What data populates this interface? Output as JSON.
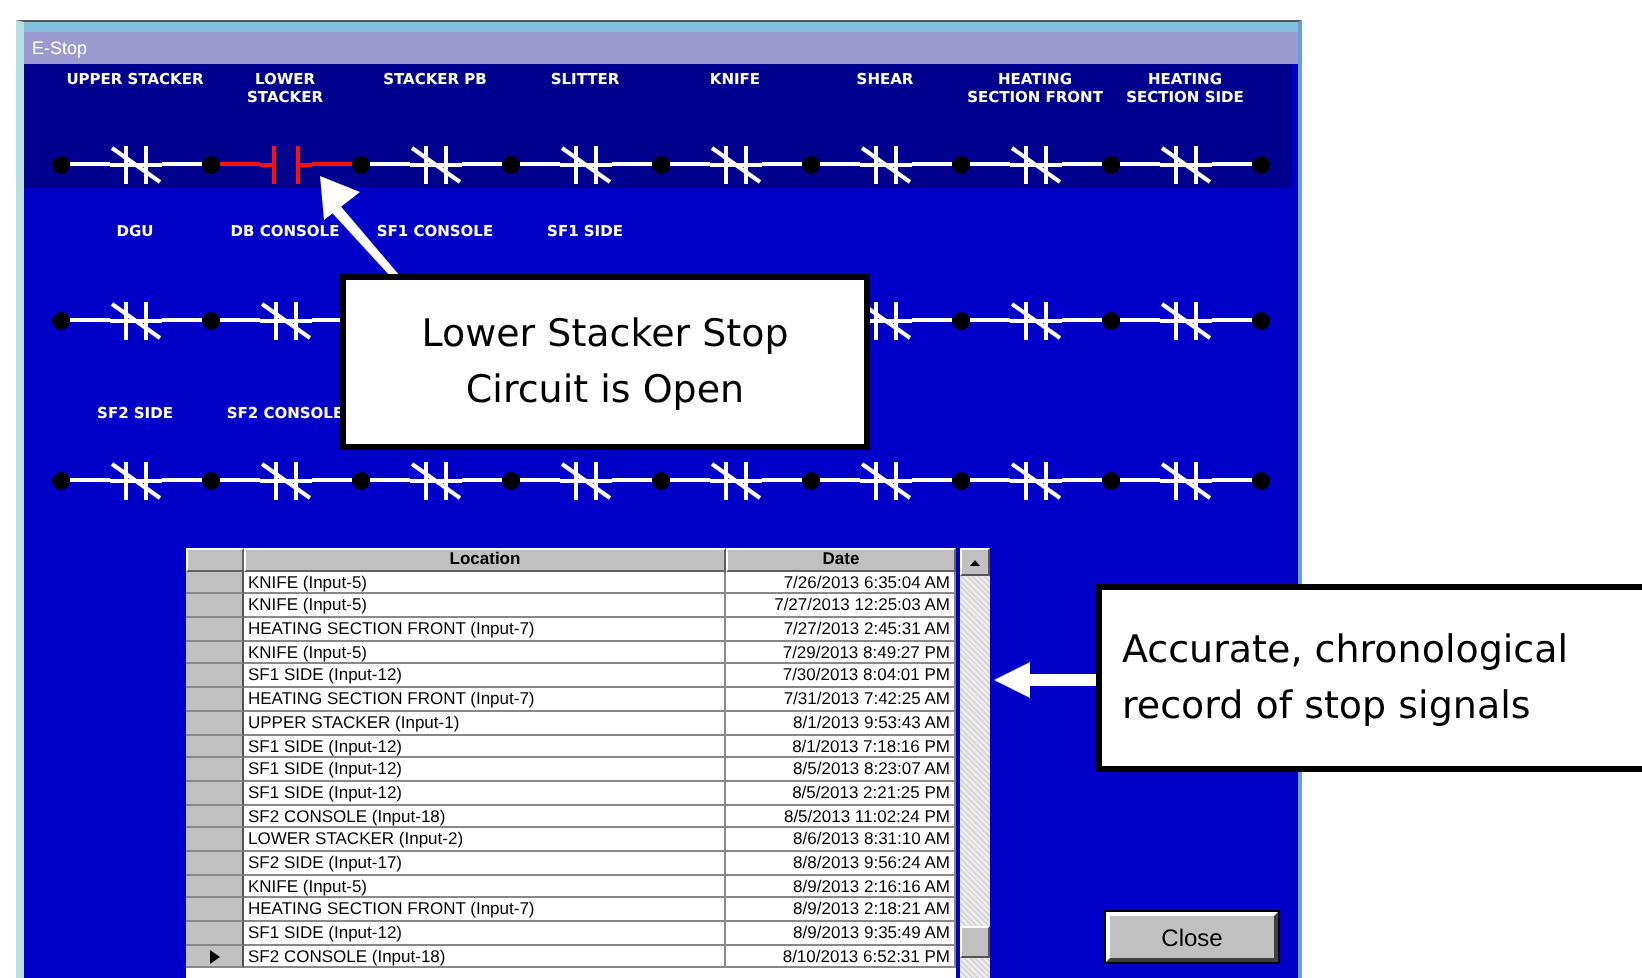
{
  "window": {
    "title": "E-Stop"
  },
  "rungs": [
    {
      "contacts": [
        {
          "label": "UPPER STACKER",
          "open": false
        },
        {
          "label": "LOWER STACKER",
          "open": true
        },
        {
          "label": "STACKER PB",
          "open": false
        },
        {
          "label": "SLITTER",
          "open": false
        },
        {
          "label": "KNIFE",
          "open": false
        },
        {
          "label": "SHEAR",
          "open": false
        },
        {
          "label": "HEATING SECTION FRONT",
          "open": false
        },
        {
          "label": "HEATING SECTION SIDE",
          "open": false
        }
      ]
    },
    {
      "contacts": [
        {
          "label": "DGU",
          "open": false
        },
        {
          "label": "DB CONSOLE",
          "open": false
        },
        {
          "label": "SF1 CONSOLE"
        },
        {
          "label": "SF1 SIDE"
        }
      ],
      "contacts_after_callout": [
        {
          "open": false
        },
        {
          "open": false
        },
        {
          "open": false
        }
      ]
    },
    {
      "contacts": [
        {
          "label": "SF2 SIDE",
          "open": false
        },
        {
          "label": "SF2 CONSOLE",
          "open": false
        },
        {
          "open": false
        },
        {
          "open": false
        },
        {
          "open": false
        },
        {
          "open": false
        },
        {
          "open": false
        },
        {
          "open": false
        }
      ]
    }
  ],
  "table": {
    "columns": [
      "Location",
      "Date"
    ],
    "rows": [
      {
        "location": "KNIFE (Input-5)",
        "date": "7/26/2013 6:35:04 AM",
        "selected": false
      },
      {
        "location": "KNIFE (Input-5)",
        "date": "7/27/2013 12:25:03 AM",
        "selected": false
      },
      {
        "location": "HEATING SECTION FRONT (Input-7)",
        "date": "7/27/2013 2:45:31 AM",
        "selected": false
      },
      {
        "location": "KNIFE (Input-5)",
        "date": "7/29/2013 8:49:27 PM",
        "selected": false
      },
      {
        "location": "SF1 SIDE (Input-12)",
        "date": "7/30/2013 8:04:01 PM",
        "selected": false
      },
      {
        "location": "HEATING SECTION FRONT (Input-7)",
        "date": "7/31/2013 7:42:25 AM",
        "selected": false
      },
      {
        "location": "UPPER STACKER (Input-1)",
        "date": "8/1/2013 9:53:43 AM",
        "selected": false
      },
      {
        "location": "SF1 SIDE (Input-12)",
        "date": "8/1/2013 7:18:16 PM",
        "selected": false
      },
      {
        "location": "SF1 SIDE (Input-12)",
        "date": "8/5/2013 8:23:07 AM",
        "selected": false
      },
      {
        "location": "SF1 SIDE (Input-12)",
        "date": "8/5/2013 2:21:25 PM",
        "selected": false
      },
      {
        "location": "SF2 CONSOLE (Input-18)",
        "date": "8/5/2013 11:02:24 PM",
        "selected": false
      },
      {
        "location": "LOWER STACKER (Input-2)",
        "date": "8/6/2013 8:31:10 AM",
        "selected": false
      },
      {
        "location": "SF2 SIDE (Input-17)",
        "date": "8/8/2013 9:56:24 AM",
        "selected": false
      },
      {
        "location": "KNIFE (Input-5)",
        "date": "8/9/2013 2:16:16 AM",
        "selected": false
      },
      {
        "location": "HEATING SECTION FRONT (Input-7)",
        "date": "8/9/2013 2:18:21 AM",
        "selected": false
      },
      {
        "location": "SF1 SIDE (Input-12)",
        "date": "8/9/2013 9:35:49 AM",
        "selected": false
      },
      {
        "location": "SF2 CONSOLE (Input-18)",
        "date": "8/10/2013 6:52:31 PM",
        "selected": true
      }
    ]
  },
  "close_button": "Close",
  "callouts": [
    "Lower Stacker Stop Circuit is Open",
    "Accurate, chronological record of stop signals"
  ]
}
